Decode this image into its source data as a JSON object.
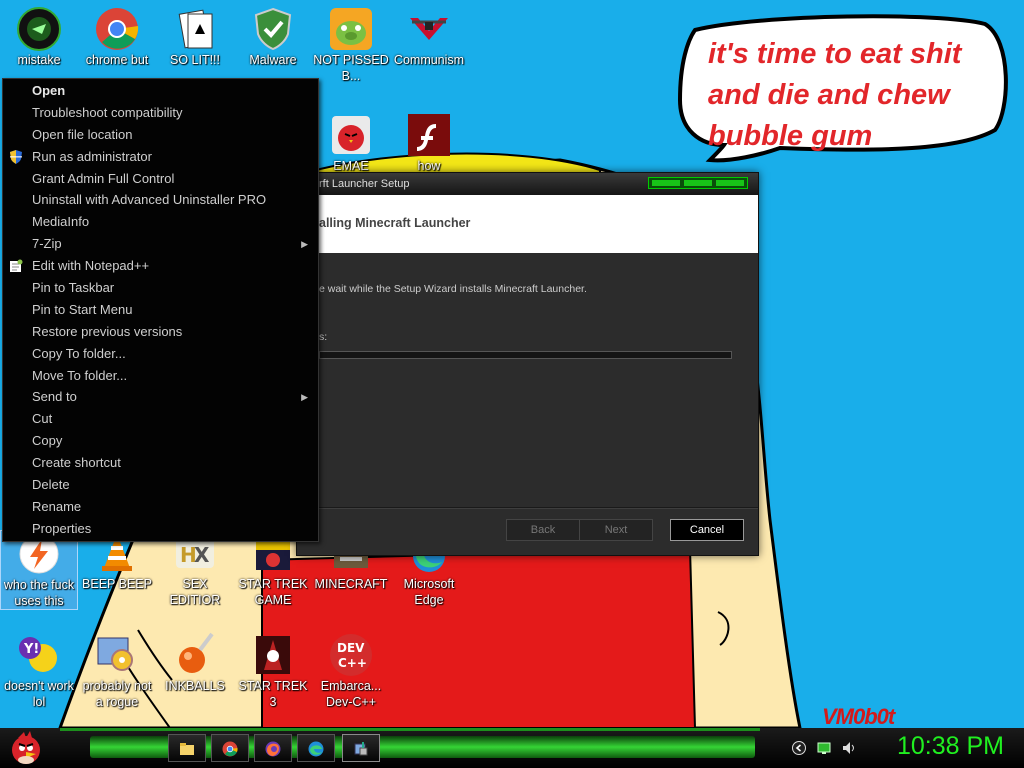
{
  "wallpaper": {
    "bubble_text": "it's time to eat shit and die and chew bubble gum",
    "watermark": "VM0b0t"
  },
  "desktop_icons": [
    {
      "name": "mistake",
      "label": "mistake",
      "icon": "gamepad-icon"
    },
    {
      "name": "chrome",
      "label": "chrome but",
      "icon": "chrome-icon"
    },
    {
      "name": "solitaire",
      "label": "SO LIT!!!",
      "icon": "cards-icon"
    },
    {
      "name": "malware",
      "label": "Malware",
      "icon": "shield-check-icon"
    },
    {
      "name": "not-pissed",
      "label": "NOT PISSED B...",
      "icon": "angry-pig-icon"
    },
    {
      "name": "communism",
      "label": "Communism",
      "icon": "emblem-icon"
    },
    {
      "name": "emae",
      "label": "EMAE",
      "icon": "angry-bird-icon"
    },
    {
      "name": "flash",
      "label": "how",
      "icon": "flash-icon"
    },
    {
      "name": "who-the-fuck",
      "label": "who the fuck uses this",
      "icon": "bolt-icon"
    },
    {
      "name": "beep-beep",
      "label": "BEEP BEEP",
      "icon": "vlc-cone-icon"
    },
    {
      "name": "sex-editior",
      "label": "SEX EDITIOR",
      "icon": "hex-editor-icon"
    },
    {
      "name": "star-trek-game",
      "label": "STAR TREK GAME",
      "icon": "star-wars-icon"
    },
    {
      "name": "minecraft",
      "label": "MINECRAFT",
      "icon": "minecraft-icon"
    },
    {
      "name": "microsoft-edge",
      "label": "Microsoft Edge",
      "icon": "edge-icon"
    },
    {
      "name": "doesnt-work",
      "label": "doesn't work lol",
      "icon": "yahoo-messenger-icon"
    },
    {
      "name": "probably-not-rogue",
      "label": "probably not a rogue",
      "icon": "gears-icon"
    },
    {
      "name": "inkballs",
      "label": "INKBALLS",
      "icon": "inkball-icon"
    },
    {
      "name": "star-trek-3",
      "label": "STAR TREK 3",
      "icon": "star-wars-icon"
    },
    {
      "name": "dev-cpp",
      "label": "Embarca... Dev-C++",
      "icon": "devcpp-icon"
    }
  ],
  "context_menu": {
    "items": [
      {
        "label": "Open",
        "bold": true
      },
      {
        "label": "Troubleshoot compatibility"
      },
      {
        "label": "Open file location"
      },
      {
        "label": "Run as administrator",
        "icon": "uac-shield-icon"
      },
      {
        "label": "Grant Admin Full Control"
      },
      {
        "label": "Uninstall with Advanced Uninstaller PRO"
      },
      {
        "label": "MediaInfo"
      },
      {
        "label": "7-Zip",
        "submenu": true
      },
      {
        "label": "Edit with Notepad++",
        "icon": "notepadpp-icon"
      },
      {
        "label": "Pin to Taskbar"
      },
      {
        "label": "Pin to Start Menu"
      },
      {
        "label": "Restore previous versions"
      },
      {
        "label": "Copy To folder..."
      },
      {
        "label": "Move To folder..."
      },
      {
        "label": "Send to",
        "submenu": true
      },
      {
        "label": "Cut"
      },
      {
        "label": "Copy"
      },
      {
        "label": "Create shortcut"
      },
      {
        "label": "Delete"
      },
      {
        "label": "Rename"
      },
      {
        "label": "Properties"
      }
    ]
  },
  "installer": {
    "title": "rft Launcher Setup",
    "header": "alling Minecraft Launcher",
    "message": "e wait while the Setup Wizard installs Minecraft Launcher.",
    "status_label": "s:",
    "progress": 0,
    "back_label": "Back",
    "next_label": "Next",
    "cancel_label": "Cancel"
  },
  "taskbar": {
    "clock": "10:38 PM",
    "pinned": [
      "explorer-icon",
      "chrome-icon",
      "firefox-icon",
      "edge-icon",
      "installer-icon"
    ],
    "tray": [
      "back-arrow-icon",
      "network-icon",
      "speaker-icon"
    ]
  },
  "colors": {
    "desktop": "#19aeea",
    "accent_green": "#20f020",
    "bubble_text": "#e2262a"
  }
}
